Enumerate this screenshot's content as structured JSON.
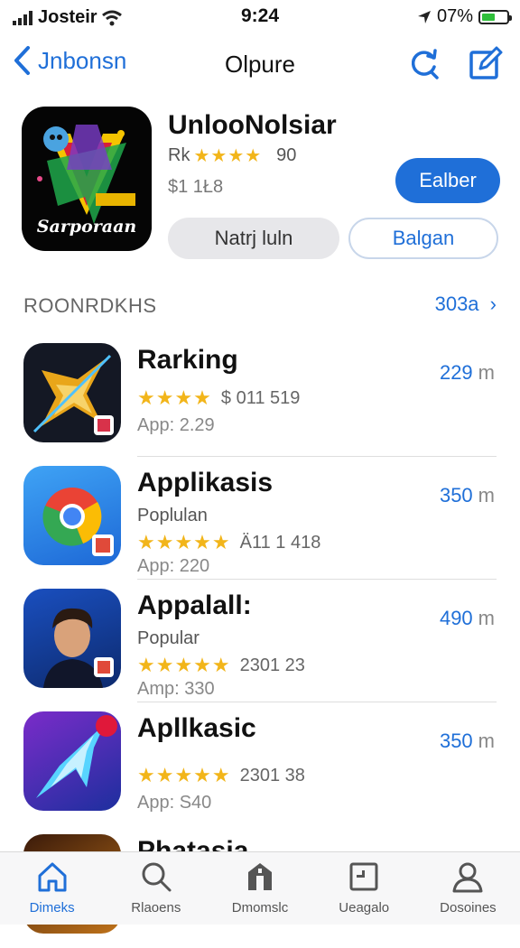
{
  "status_bar": {
    "carrier": "Josteir",
    "time": "9:24",
    "battery": "07%"
  },
  "nav": {
    "back_label": "Jnbonsn",
    "title": "Olpure"
  },
  "featured": {
    "name": "UnlooNolsiar",
    "rating_prefix": "Rk",
    "stars": "★★★★",
    "rating_count": "90",
    "price": "$1 1Ł8",
    "get_button": "Ealber",
    "secondary_button_1": "Natrj luln",
    "secondary_button_2": "Balgan",
    "icon_text": "Sarporaan"
  },
  "section": {
    "title": "ROONRDKHS",
    "link": "303a"
  },
  "apps": [
    {
      "name": "Rarking",
      "sub": "",
      "stars": "★★★★",
      "meta": "$ 011 519",
      "category": "App: 2.29",
      "size": "229",
      "unit": "m"
    },
    {
      "name": "Applikasis",
      "sub": "Poplulan",
      "stars": "★★★★★",
      "meta": "Ä11 1 418",
      "category": "App: 220",
      "size": "350",
      "unit": "m"
    },
    {
      "name": "Appalall:",
      "sub": "Popular",
      "stars": "★★★★★",
      "meta": "2301 23",
      "category": "Amp: 330",
      "size": "490",
      "unit": "m"
    },
    {
      "name": "Apllkasic",
      "sub": "",
      "stars": "★★★★★",
      "meta": "2301 38",
      "category": "App: S40",
      "size": "350",
      "unit": "m"
    },
    {
      "name": "Phatasia",
      "sub": "",
      "stars": "",
      "meta": "",
      "category": "",
      "size": "",
      "unit": ""
    }
  ],
  "tabs": [
    {
      "label": "Dimeks",
      "icon": "home-icon"
    },
    {
      "label": "Rlaoens",
      "icon": "search-icon"
    },
    {
      "label": "Dmomslc",
      "icon": "store-icon"
    },
    {
      "label": "Ueagalo",
      "icon": "updates-icon"
    },
    {
      "label": "Dosoines",
      "icon": "person-icon"
    }
  ],
  "colors": {
    "accent": "#1f6fd8",
    "star": "#f2b51a",
    "battery": "#2fbf3a"
  }
}
